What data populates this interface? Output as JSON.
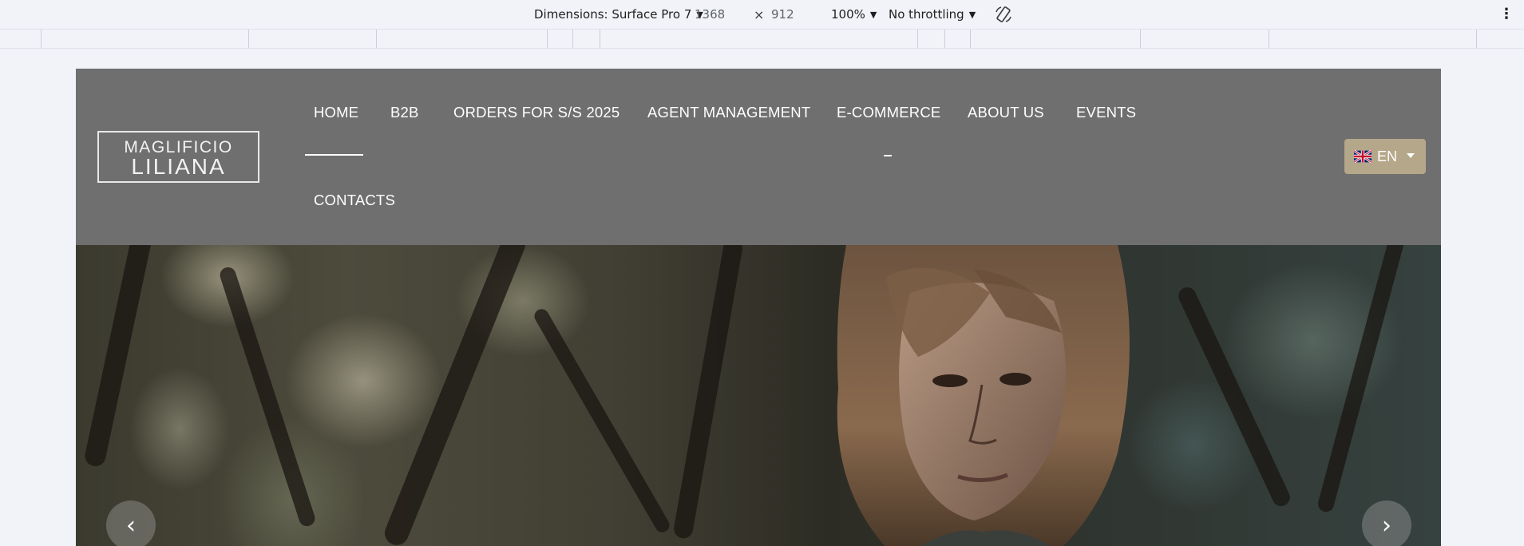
{
  "devtools": {
    "dimensions_label": "Dimensions: Surface Pro 7",
    "width": "1368",
    "times": "×",
    "height": "912",
    "zoom": "100%",
    "throttling": "No throttling",
    "rotate_icon": "rotate-icon",
    "more_icon": "more-options-icon"
  },
  "site": {
    "logo": {
      "line1": "MAGLIFICIO",
      "line2": "LILIANA"
    },
    "nav": [
      {
        "label": "HOME",
        "active": true
      },
      {
        "label": "B2B"
      },
      {
        "label": "ORDERS FOR S/S 2025"
      },
      {
        "label": "AGENT MANAGEMENT"
      },
      {
        "label": "E-COMMERCE"
      },
      {
        "label": "ABOUT US"
      },
      {
        "label": "EVENTS"
      },
      {
        "label": "CONTACTS"
      }
    ],
    "language": {
      "label": "EN",
      "flag_icon": "uk-flag-icon"
    },
    "hero": {
      "prev_icon": "chevron-left-icon",
      "next_icon": "chevron-right-icon",
      "prev_glyph": "‹",
      "next_glyph": "›"
    },
    "colors": {
      "header_bg": "#6f6f6f",
      "lang_bg": "#b5a78a"
    }
  }
}
